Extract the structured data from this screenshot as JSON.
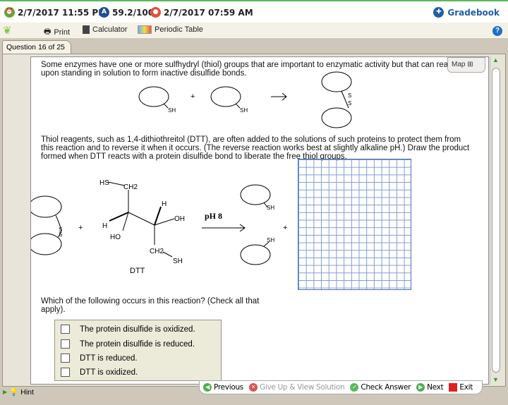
{
  "header": {
    "due_date": "2/7/2017 11:55 PM",
    "score": "59.2/100",
    "start_date": "2/7/2017 07:59 AM",
    "gradebook": "Gradebook"
  },
  "toolbar": {
    "print": "Print",
    "calculator": "Calculator",
    "periodic_table": "Periodic Table",
    "help": "?"
  },
  "tab": {
    "label": "Question 16 of 25"
  },
  "map": {
    "label": "Map"
  },
  "question": {
    "intro": "Some enzymes have one or more sulfhydryl (thiol) groups that are important to enzymatic activity but that can react upon standing in solution to form inactive disulfide bonds.",
    "paragraph": "Thiol reagents, such as 1,4-dithiothreitol (DTT), are often added to the solutions of such proteins to protect them from this reaction and to reverse it when it occurs. (The reverse reaction works best at slightly alkaline pH.) Draw the product formed when DTT reacts with a protein disulfide bond to liberate the free thiol groups.",
    "prompt": "Which of the following occurs in this reaction? (Check all that apply).",
    "scheme1": {
      "plus": "+",
      "sh": "SH",
      "s": "S"
    },
    "scheme2": {
      "hs": "HS",
      "ch2": "CH2",
      "h": "H",
      "oh": "OH",
      "ho": "HO",
      "sh": "SH",
      "dtt": "DTT",
      "condition": "pH  8",
      "plus": "+",
      "s": "S"
    },
    "options": [
      "The protein disulfide is oxidized.",
      "The protein disulfide is reduced.",
      "DTT is reduced.",
      "DTT is oxidized."
    ]
  },
  "nav": {
    "previous": "Previous",
    "give_up": "Give Up & View Solution",
    "check": "Check Answer",
    "next": "Next",
    "exit": "Exit"
  },
  "hint": {
    "label": "Hint"
  }
}
